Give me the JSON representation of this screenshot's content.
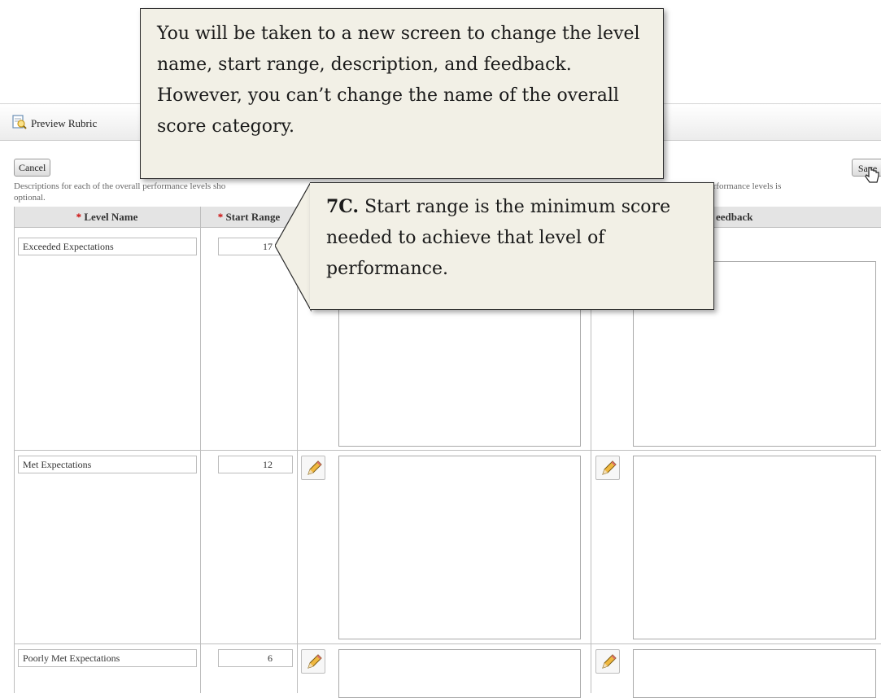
{
  "toolbar": {
    "preview_label": "Preview Rubric"
  },
  "buttons": {
    "cancel": "Cancel",
    "save": "Save"
  },
  "description": {
    "left": "Descriptions for each of the overall performance levels sho",
    "left_line2": "optional.",
    "right": "erall performance levels is"
  },
  "columns": {
    "level_name": "Level Name",
    "start_range": "Start Range",
    "feedback": "eedback"
  },
  "rows": [
    {
      "name": "Exceeded Expectations",
      "start": "17"
    },
    {
      "name": "Met Expectations",
      "start": "12"
    },
    {
      "name": "Poorly Met Expectations",
      "start": "6"
    }
  ],
  "callouts": {
    "main": "You will be taken to a new screen to change the level name, start range, description, and feedback.  However, you can’t change the name of the overall score category.",
    "step_label": "7C.",
    "step_text": " Start range is the minimum score needed to achieve that level of performance."
  },
  "colors": {
    "required": "#cc0000",
    "header_bg": "#e4e4e4",
    "callout_bg": "#f2f0e6"
  }
}
